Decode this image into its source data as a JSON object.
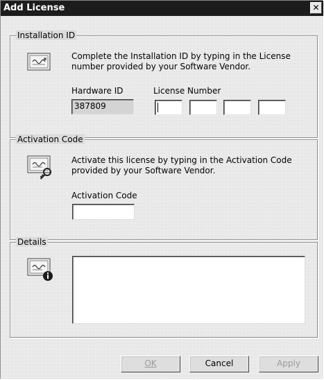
{
  "window": {
    "title": "Add License",
    "close_glyph": "✕"
  },
  "installation": {
    "legend": "Installation ID",
    "description": "Complete the Installation ID by typing in the License number provided by your Software Vendor.",
    "hardware_label": "Hardware ID",
    "hardware_value": "387809",
    "license_label": "License Number",
    "license_parts": [
      "",
      "",
      "",
      ""
    ]
  },
  "activation": {
    "legend": "Activation Code",
    "description": "Activate this license by typing in the Activation Code provided by your Software Vendor.",
    "code_label": "Activation Code",
    "code_value": ""
  },
  "details": {
    "legend": "Details",
    "text": ""
  },
  "buttons": {
    "ok": "OK",
    "cancel": "Cancel",
    "apply": "Apply"
  },
  "icons": {
    "installation": "certificate-icon",
    "activation": "certificate-key-icon",
    "details": "certificate-info-icon"
  }
}
